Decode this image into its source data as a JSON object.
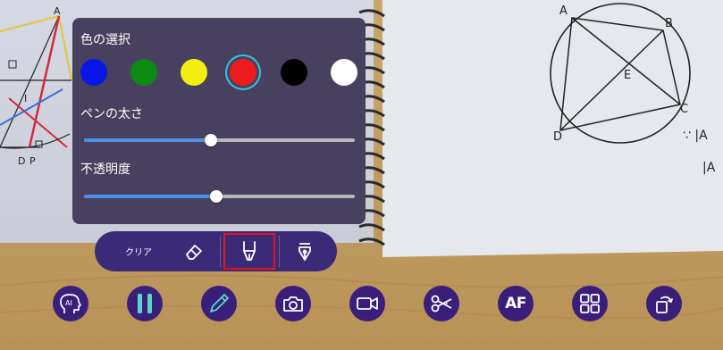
{
  "pen_panel": {
    "color_heading": "色の選択",
    "colors": [
      {
        "name": "blue",
        "hex": "#0a16e6",
        "selected": false
      },
      {
        "name": "green",
        "hex": "#0b8a14",
        "selected": false
      },
      {
        "name": "yellow",
        "hex": "#f2ee12",
        "selected": false
      },
      {
        "name": "red",
        "hex": "#ec1c1c",
        "selected": true
      },
      {
        "name": "black",
        "hex": "#000000",
        "selected": false
      },
      {
        "name": "white",
        "hex": "#ffffff",
        "selected": false
      }
    ],
    "width_heading": "ペンの太さ",
    "width_value": 0.47,
    "opacity_heading": "不透明度",
    "opacity_value": 0.49
  },
  "tool_strip": {
    "clear_label": "クリア",
    "tools": [
      {
        "name": "eraser",
        "icon": "eraser-icon",
        "selected": false
      },
      {
        "name": "pen",
        "icon": "pen-tip-icon",
        "selected": true
      },
      {
        "name": "fountain-pen",
        "icon": "fountain-pen-icon",
        "selected": false
      }
    ]
  },
  "main_toolbar": {
    "buttons": [
      {
        "name": "ai",
        "icon": "ai-head-icon",
        "label": "AI"
      },
      {
        "name": "pause",
        "icon": "pause-icon"
      },
      {
        "name": "pen",
        "icon": "pencil-icon"
      },
      {
        "name": "camera",
        "icon": "camera-icon"
      },
      {
        "name": "video",
        "icon": "video-icon"
      },
      {
        "name": "crop",
        "icon": "scissors-icon"
      },
      {
        "name": "autofocus",
        "icon": "af-icon",
        "label": "AF"
      },
      {
        "name": "grid",
        "icon": "grid-icon"
      },
      {
        "name": "rotate",
        "icon": "rotate-icon"
      }
    ]
  },
  "background": {
    "left_labels": [
      "A",
      "I",
      "D",
      "P"
    ],
    "right_labels": [
      "A",
      "B",
      "E",
      "C",
      "D"
    ],
    "math_fragments": [
      "∵ |A",
      "|A"
    ]
  },
  "colors": {
    "panel_bg": "#47405e",
    "toolbar_bg": "#3a1f7a",
    "selection_ring": "#33c4e0",
    "active_tool_border": "#e3141b",
    "slider_fill": "#4d8fe6"
  }
}
